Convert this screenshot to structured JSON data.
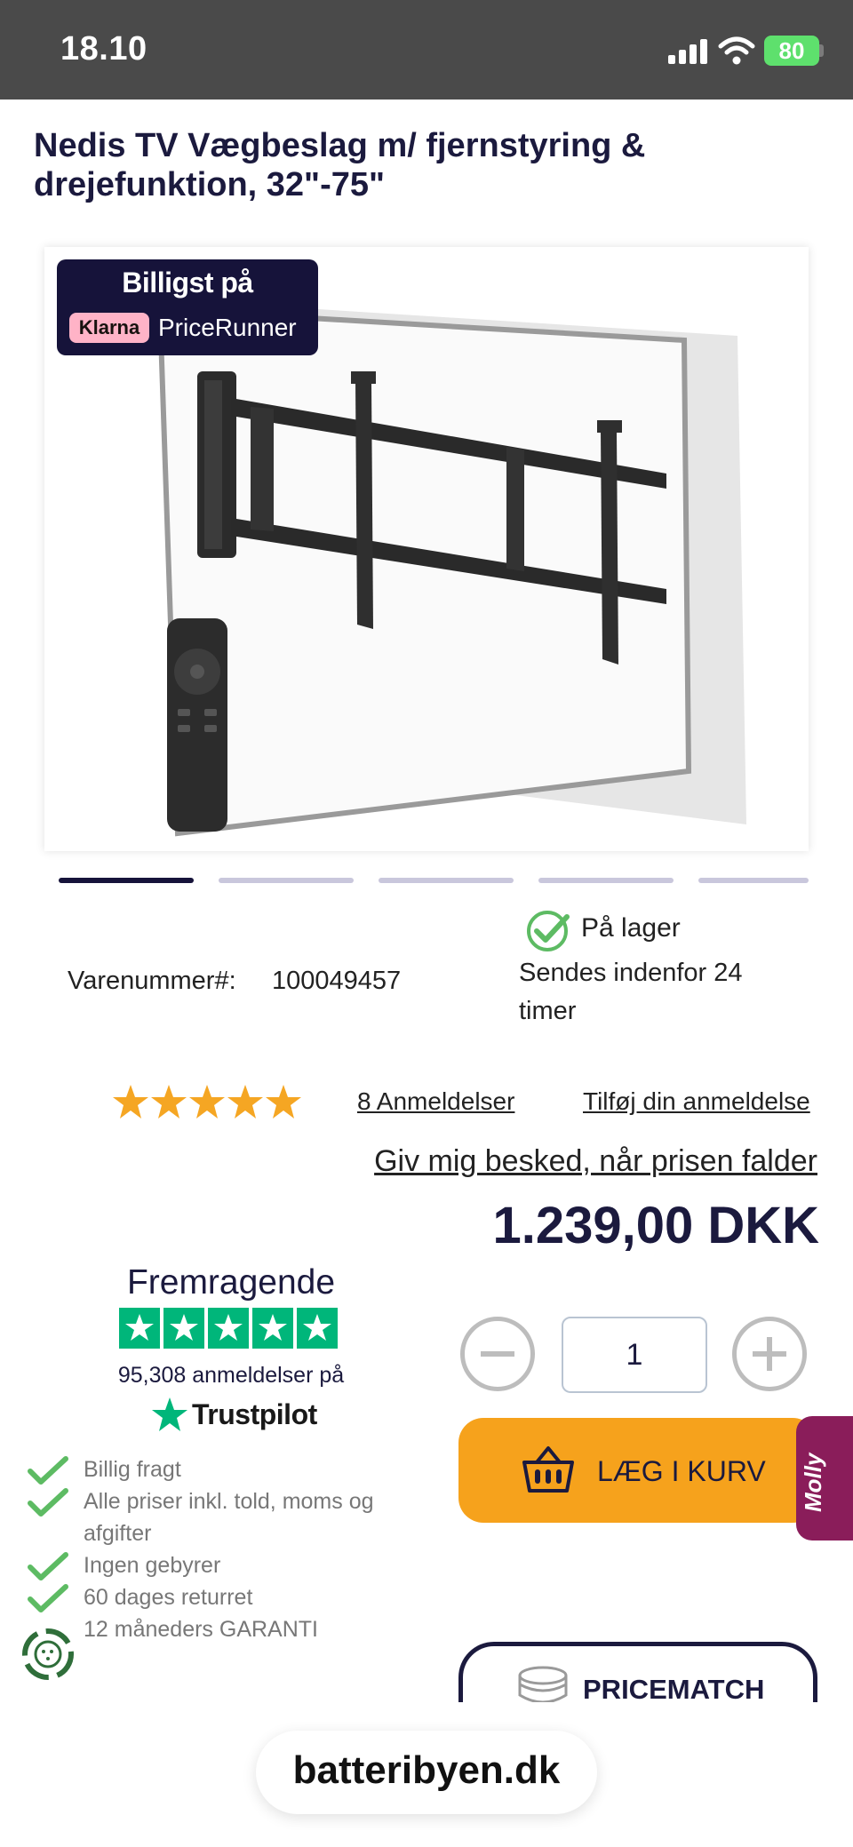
{
  "status_bar": {
    "time": "18.10",
    "battery": "80"
  },
  "product": {
    "title": "Nedis TV Vægbeslag m/ fjernstyring & drejefunktion, 32\"-75\"",
    "badge_title": "Billigst på",
    "badge_klarna": "Klarna",
    "badge_pricerunner": "PriceRunner",
    "gallery_count": 5,
    "gallery_active": 0
  },
  "stock": {
    "label": "På lager",
    "shipping": "Sendes indenfor 24 timer"
  },
  "sku": {
    "label": "Varenummer#:",
    "value": "100049457"
  },
  "rating": {
    "stars": 5,
    "reviews_link": "8  Anmeldelser",
    "add_review": "Tilføj din anmeldelse",
    "notify": "Giv mig besked, når prisen falder"
  },
  "price": "1.239,00 DKK",
  "trustpilot": {
    "rating_text": "Fremragende",
    "count_text": "95,308 anmeldelser på",
    "brand": "Trustpilot"
  },
  "quantity": "1",
  "cart": {
    "label": "LÆG I KURV"
  },
  "chat": {
    "label": "Molly"
  },
  "benefits": [
    "Billig fragt",
    "Alle priser inkl. told, moms og afgifter",
    "Ingen gebyrer",
    "60 dages returret",
    "12 måneders GARANTI"
  ],
  "pricematch": {
    "label": "PRICEMATCH"
  },
  "url": "batteribyen.dk",
  "colors": {
    "navy": "#1b1a3e",
    "orange": "#f6a21c",
    "trustpilot_green": "#00b67a",
    "check_green": "#5dbb63",
    "molly": "#8a1d5a"
  }
}
